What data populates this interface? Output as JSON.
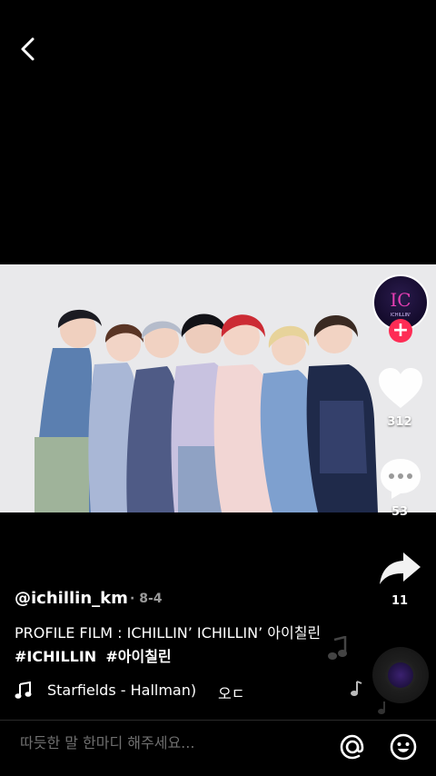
{
  "video": {
    "username": "@ichillin_km",
    "date": "8-4",
    "caption_text": "PROFILE FILM : ICHILLIN’ ICHILLIN’ 아이칠린 ",
    "hashtags": [
      "#ICHILLIN",
      "#아이칠린"
    ],
    "music": "Starfields - Hallman)",
    "music_trailing": "오ㄷ"
  },
  "actions": {
    "likes": "312",
    "comments": "53",
    "shares": "11",
    "follow_symbol": "+"
  },
  "avatar": {
    "logo_text": "IC",
    "logo_subtext": "ICHILLIN'"
  },
  "comment_bar": {
    "placeholder": "따듯한 말 한마디 해주세요..."
  },
  "icons": [
    "back-icon",
    "heart-icon",
    "comment-icon",
    "share-icon",
    "music-note-icon",
    "mention-icon",
    "emoji-icon",
    "music-disc-icon"
  ],
  "colors": {
    "background": "#000000",
    "follow_button": "#fe2c55",
    "secondary_text": "#9a9a9a",
    "placeholder_text": "#6f6f6f"
  }
}
